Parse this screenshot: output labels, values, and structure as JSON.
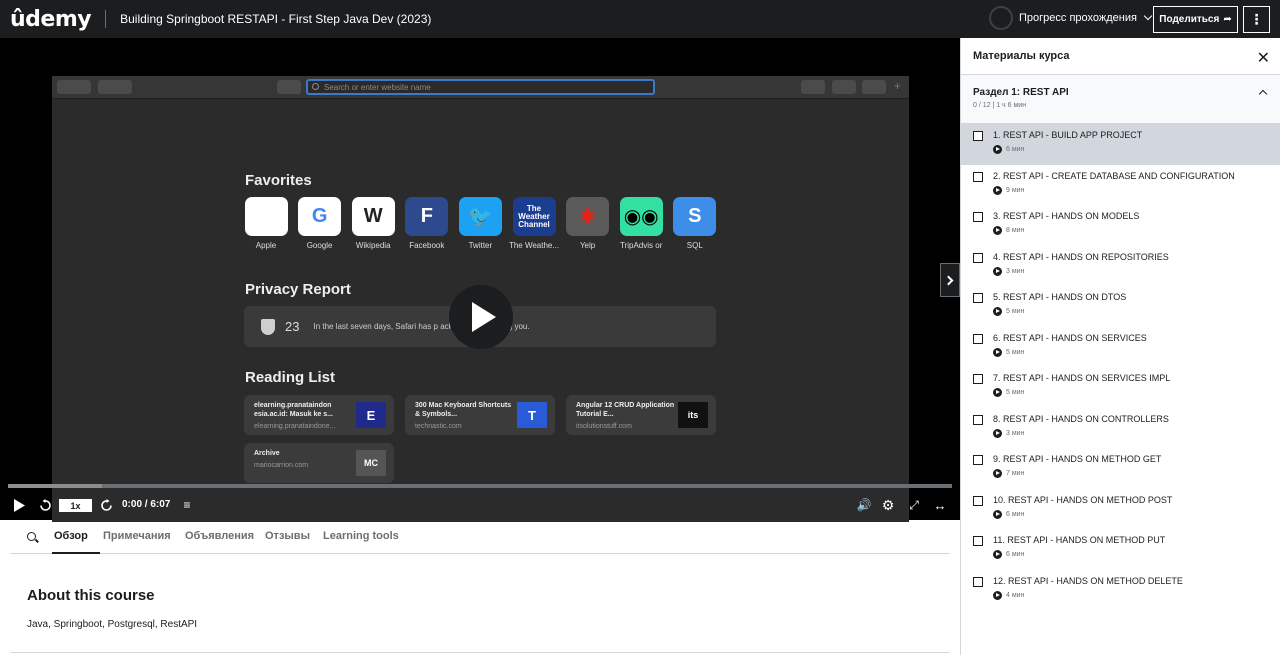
{
  "header": {
    "logo": "ûdemy",
    "course_title": "Building Springboot RESTAPI - First Step Java Dev (2023)",
    "progress_label": "Прогресс прохождения",
    "share_label": "Поделиться",
    "more_label": "⋮"
  },
  "browser": {
    "address_placeholder": "Search or enter website name",
    "favorites_title": "Favorites",
    "favorites": [
      {
        "label": "Apple",
        "glyph": "",
        "bg": "#ffffff",
        "fg": "#555555"
      },
      {
        "label": "Google",
        "glyph": "G",
        "bg": "#ffffff",
        "fg": "#4285f4"
      },
      {
        "label": "Wikipedia",
        "glyph": "W",
        "bg": "#ffffff",
        "fg": "#222222"
      },
      {
        "label": "Facebook",
        "glyph": "F",
        "bg": "#2d4a8f",
        "fg": "#ffffff"
      },
      {
        "label": "Twitter",
        "glyph": "🐦",
        "bg": "#1da1f2",
        "fg": "#ffffff"
      },
      {
        "label": "The Weathe...",
        "glyph": "The Weather Channel",
        "bg": "#1b3d8f",
        "fg": "#ffffff"
      },
      {
        "label": "Yelp",
        "glyph": "✱",
        "bg": "#5a5a5a",
        "fg": "#e2231a"
      },
      {
        "label": "TripAdvis or",
        "glyph": "◉◉",
        "bg": "#34e0a1",
        "fg": "#000000"
      },
      {
        "label": "SQL",
        "glyph": "S",
        "bg": "#3c8ee8",
        "fg": "#ffffff"
      }
    ],
    "privacy_title": "Privacy Report",
    "privacy_count": "23",
    "privacy_text": "In the last seven days, Safari has p         ackers from profiling you.",
    "reading_title": "Reading List",
    "reading": [
      {
        "title": "elearning.pranataindon esia.ac.id: Masuk ke s...",
        "sub": "elearning.pranataindone...",
        "thumb": "E",
        "thumb_bg": "#1f2a8a"
      },
      {
        "title": "300 Mac Keyboard Shortcuts & Symbols...",
        "sub": "technastic.com",
        "thumb": "T",
        "thumb_bg": "#2a5bd7"
      },
      {
        "title": "Angular 12 CRUD Application Tutorial E...",
        "sub": "itsolutionstuff.com",
        "thumb": "its",
        "thumb_bg": "#111111"
      },
      {
        "title": "Archive",
        "sub": "mariocarrion.com",
        "thumb": "MC",
        "thumb_bg": "#555555"
      }
    ]
  },
  "player": {
    "speed": "1x",
    "time": "0:00 / 6:07",
    "buffered_fraction": 0.1
  },
  "tabs": [
    "Обзор",
    "Примечания",
    "Объявления",
    "Отзывы",
    "Learning tools"
  ],
  "about": {
    "title": "About this course",
    "text": "Java, Springboot, Postgresql, RestAPI"
  },
  "sidebar": {
    "title": "Материалы курса",
    "section_title": "Раздел 1: REST API",
    "section_meta": "0 / 12 | 1 ч 6 мин",
    "lectures": [
      {
        "title": "1. REST API - BUILD APP PROJECT",
        "duration": "6 мин"
      },
      {
        "title": "2. REST API - CREATE DATABASE AND CONFIGURATION",
        "duration": "9 мин"
      },
      {
        "title": "3. REST API - HANDS ON MODELS",
        "duration": "8 мин"
      },
      {
        "title": "4. REST API - HANDS ON REPOSITORIES",
        "duration": "3 мин"
      },
      {
        "title": "5. REST API - HANDS ON DTOS",
        "duration": "5 мин"
      },
      {
        "title": "6. REST API - HANDS ON SERVICES",
        "duration": "5 мин"
      },
      {
        "title": "7. REST API - HANDS ON SERVICES IMPL",
        "duration": "5 мин"
      },
      {
        "title": "8. REST API - HANDS ON CONTROLLERS",
        "duration": "3 мин"
      },
      {
        "title": "9. REST API - HANDS ON METHOD GET",
        "duration": "7 мин"
      },
      {
        "title": "10. REST API - HANDS ON METHOD POST",
        "duration": "6 мин"
      },
      {
        "title": "11. REST API - HANDS ON METHOD PUT",
        "duration": "6 мин"
      },
      {
        "title": "12. REST API - HANDS ON METHOD DELETE",
        "duration": "4 мин"
      }
    ]
  }
}
